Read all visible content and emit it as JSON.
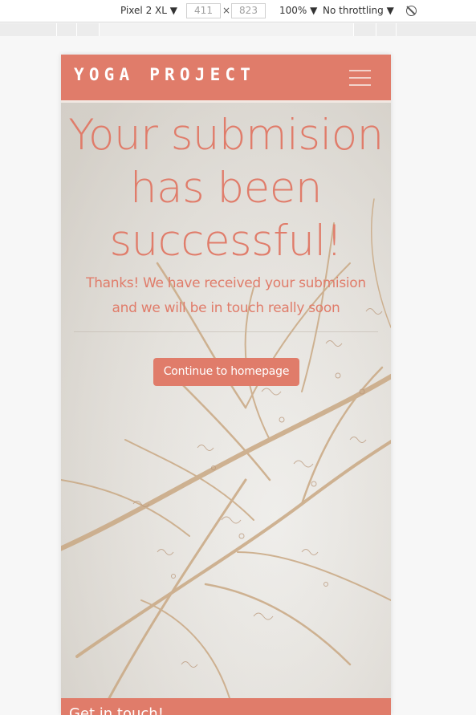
{
  "devtools": {
    "device": "Pixel 2 XL ▼",
    "width": "411",
    "times": "×",
    "height": "823",
    "zoom": "100% ▼",
    "throttling": "No throttling ▼",
    "rotate_icon": "rotate-icon"
  },
  "navbar": {
    "brand": "YOGA PROJECT",
    "menu_icon": "hamburger-menu-icon",
    "color": "#e07c6a"
  },
  "hero": {
    "headline": "Your submision has been successful!",
    "subtext": "Thanks! We have received your submision and we will be in touch really soon",
    "button_label": "Continue to homepage"
  },
  "footer": {
    "title": "Get in touch!"
  },
  "colors": {
    "accent": "#e07c6a",
    "white": "#ffffff"
  }
}
